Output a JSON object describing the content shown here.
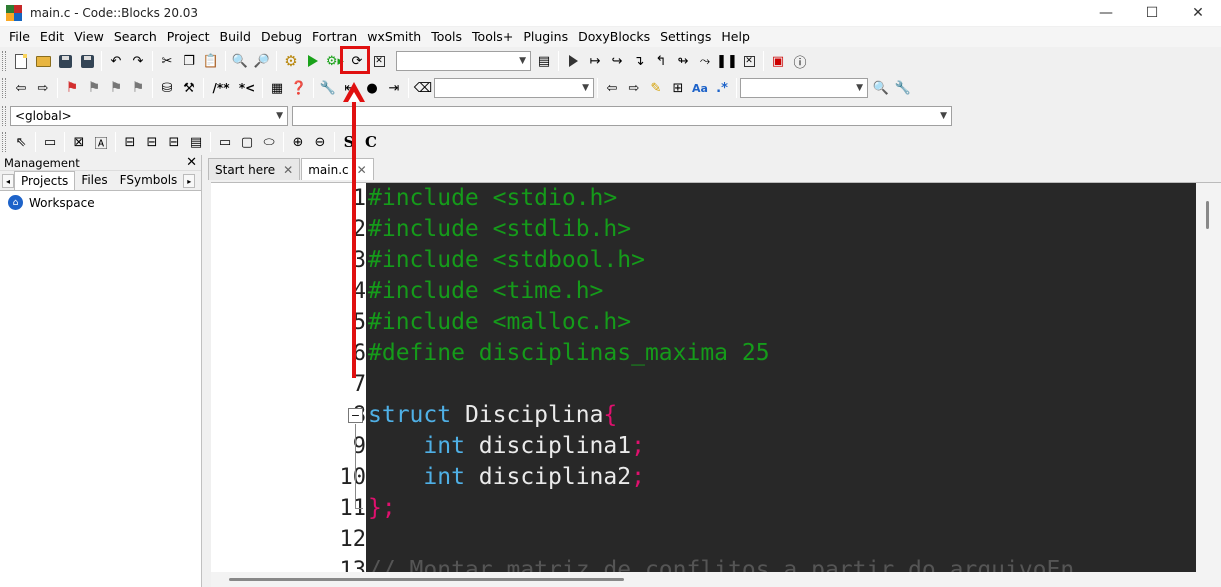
{
  "window": {
    "title": "main.c - Code::Blocks 20.03",
    "minimize": "—",
    "maximize": "☐",
    "close": "✕"
  },
  "menu": [
    {
      "label": "File"
    },
    {
      "label": "Edit"
    },
    {
      "label": "View"
    },
    {
      "label": "Search"
    },
    {
      "label": "Project"
    },
    {
      "label": "Build"
    },
    {
      "label": "Debug"
    },
    {
      "label": "Fortran"
    },
    {
      "label": "wxSmith"
    },
    {
      "label": "Tools"
    },
    {
      "label": "Tools+"
    },
    {
      "label": "Plugins"
    },
    {
      "label": "DoxyBlocks"
    },
    {
      "label": "Settings"
    },
    {
      "label": "Help"
    }
  ],
  "toolbar": {
    "doxy_comment": "/**",
    "doxy_inline": "*<",
    "regex_label": ".*",
    "aa_label": "Aa",
    "s_label": "S",
    "c_label": "C"
  },
  "scope": {
    "value": "<global>"
  },
  "management": {
    "title": "Management",
    "tabs": [
      "Projects",
      "Files",
      "FSymbols"
    ],
    "workspace": "Workspace"
  },
  "editor": {
    "tabs": [
      {
        "label": "Start here",
        "active": false
      },
      {
        "label": "main.c",
        "active": true
      }
    ],
    "lines": [
      {
        "n": "1",
        "parts": [
          {
            "t": "#include <stdio.h>",
            "c": "pp"
          }
        ]
      },
      {
        "n": "2",
        "parts": [
          {
            "t": "#include <stdlib.h>",
            "c": "pp"
          }
        ]
      },
      {
        "n": "3",
        "parts": [
          {
            "t": "#include <stdbool.h>",
            "c": "pp"
          }
        ]
      },
      {
        "n": "4",
        "parts": [
          {
            "t": "#include <time.h>",
            "c": "pp"
          }
        ]
      },
      {
        "n": "5",
        "parts": [
          {
            "t": "#include <malloc.h>",
            "c": "pp"
          }
        ]
      },
      {
        "n": "6",
        "parts": [
          {
            "t": "#define disciplinas_maxima 25",
            "c": "pp"
          }
        ]
      },
      {
        "n": "7",
        "parts": []
      },
      {
        "n": "8",
        "parts": [
          {
            "t": "struct",
            "c": "kw"
          },
          {
            "t": " Disciplina",
            "c": "tx"
          },
          {
            "t": "{",
            "c": "pu"
          }
        ]
      },
      {
        "n": "9",
        "parts": [
          {
            "t": "    ",
            "c": "tx"
          },
          {
            "t": "int",
            "c": "kw"
          },
          {
            "t": " disciplina1",
            "c": "tx"
          },
          {
            "t": ";",
            "c": "pu"
          }
        ]
      },
      {
        "n": "10",
        "parts": [
          {
            "t": "    ",
            "c": "tx"
          },
          {
            "t": "int",
            "c": "kw"
          },
          {
            "t": " disciplina2",
            "c": "tx"
          },
          {
            "t": ";",
            "c": "pu"
          }
        ]
      },
      {
        "n": "11",
        "parts": [
          {
            "t": "}",
            "c": "pu"
          },
          {
            "t": ";",
            "c": "pu"
          }
        ]
      },
      {
        "n": "12",
        "parts": []
      },
      {
        "n": "13",
        "parts": [
          {
            "t": "// Montar matriz de conflitos a partir do arquivoEn",
            "c": "cm"
          }
        ]
      }
    ]
  },
  "colors": {
    "highlight": "#e01010",
    "code_background": "#282828",
    "preprocessor": "#159b1a",
    "keyword": "#4fb0e6"
  }
}
